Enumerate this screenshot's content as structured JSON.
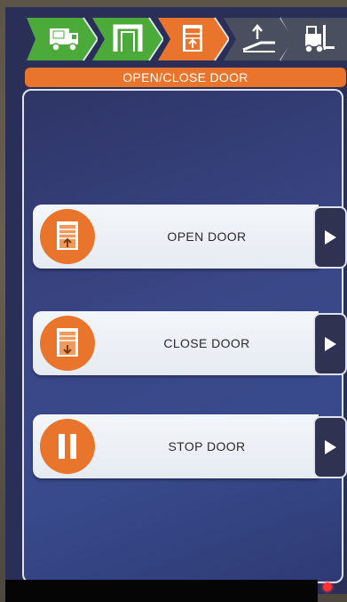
{
  "screen_title": "OPEN/CLOSE DOOR",
  "steps": [
    {
      "name": "delivery-truck",
      "icon": "truck-icon",
      "state": "done",
      "color": "#4caa3b"
    },
    {
      "name": "door-frame",
      "icon": "door-frame-icon",
      "state": "done",
      "color": "#4caa3b"
    },
    {
      "name": "open-close-door",
      "icon": "roller-door-icon",
      "state": "active",
      "color": "#e8752b"
    },
    {
      "name": "dock-leveler",
      "icon": "leveler-icon",
      "state": "pending",
      "color": "#4a4f60"
    },
    {
      "name": "forklift",
      "icon": "forklift-icon",
      "state": "pending",
      "color": "#4a4f60"
    }
  ],
  "actions": [
    {
      "label": "OPEN DOOR",
      "icon": "door-open-icon"
    },
    {
      "label": "CLOSE DOOR",
      "icon": "door-close-icon"
    },
    {
      "label": "STOP DOOR",
      "icon": "pause-icon"
    }
  ],
  "colors": {
    "accent": "#e8752b",
    "done": "#4caa3b",
    "pending": "#4a4f60",
    "panel": "#3a4787"
  }
}
